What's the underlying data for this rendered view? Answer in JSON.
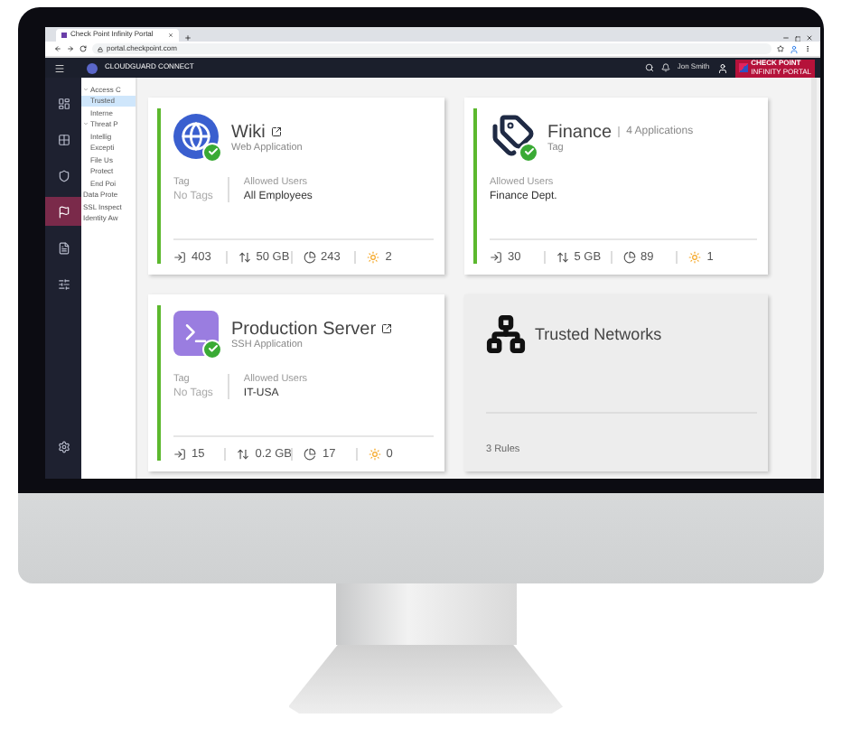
{
  "browser": {
    "tab": "Check Point Infinity Portal",
    "url": "portal.checkpoint.com"
  },
  "header": {
    "product": "CLOUDGUARD CONNECT",
    "user": "Jon Smith",
    "brand": "CHECK POINT",
    "brand_sub": "INFINITY PORTAL"
  },
  "nav": [
    {
      "kind": "dashboard",
      "selected": false
    },
    {
      "kind": "overview",
      "selected": false
    },
    {
      "kind": "assets",
      "selected": false
    },
    {
      "kind": "policy",
      "selected": true
    },
    {
      "kind": "logs",
      "selected": false
    },
    {
      "kind": "settings",
      "selected": false
    },
    {
      "kind": "global",
      "selected": false
    }
  ],
  "tree": [
    {
      "label": "Access C",
      "expanded": true,
      "selected": false,
      "children": [
        {
          "label": "Trusted",
          "selected": true
        },
        {
          "label": "Interne",
          "selected": false
        }
      ]
    },
    {
      "label": "Threat P",
      "expanded": true,
      "selected": false,
      "children": [
        {
          "label": "Intellig",
          "selected": false
        },
        {
          "label": "Excepti",
          "selected": false
        },
        {
          "label": "File Us",
          "selected": false
        },
        {
          "label": "Protect",
          "selected": false
        },
        {
          "label": "End Poi",
          "selected": false
        }
      ]
    },
    {
      "label": "Data Prote",
      "selected": false
    },
    {
      "label": "SSL Inspect",
      "selected": false
    },
    {
      "label": "Identity Aw",
      "selected": false
    }
  ],
  "cards": [
    {
      "kind": "web_application",
      "title": "Wiki",
      "external_link": true,
      "subtitle": "Web Application",
      "status_ok": true,
      "tag_label": "Tag",
      "tag_value": "No Tags",
      "users_label": "Allowed Users",
      "users_value": "All Employees",
      "stats": [
        {
          "kind": "sessions",
          "value": "403"
        },
        {
          "kind": "traffic",
          "value": "50 GB"
        },
        {
          "kind": "visits",
          "value": "243"
        },
        {
          "kind": "alerts",
          "value": "2"
        }
      ]
    },
    {
      "kind": "tag",
      "title": "Finance",
      "count": "4 Applications",
      "subtitle": "Tag",
      "status_ok": true,
      "users_label": "Allowed Users",
      "users_value": "Finance Dept.",
      "stats": [
        {
          "kind": "sessions",
          "value": "30"
        },
        {
          "kind": "traffic",
          "value": "5 GB"
        },
        {
          "kind": "visits",
          "value": "89"
        },
        {
          "kind": "alerts",
          "value": "1"
        }
      ]
    },
    {
      "kind": "ssh_application",
      "title": "Production Server",
      "external_link": true,
      "subtitle": "SSH Application",
      "status_ok": true,
      "tag_label": "Tag",
      "tag_value": "No Tags",
      "users_label": "Allowed Users",
      "users_value": "IT-USA",
      "stats": [
        {
          "kind": "sessions",
          "value": "15"
        },
        {
          "kind": "traffic",
          "value": "0.2 GB"
        },
        {
          "kind": "visits",
          "value": "17"
        },
        {
          "kind": "alerts",
          "value": "0"
        }
      ]
    },
    {
      "kind": "network",
      "title": "Trusted Networks",
      "footer": "3 Rules"
    }
  ]
}
